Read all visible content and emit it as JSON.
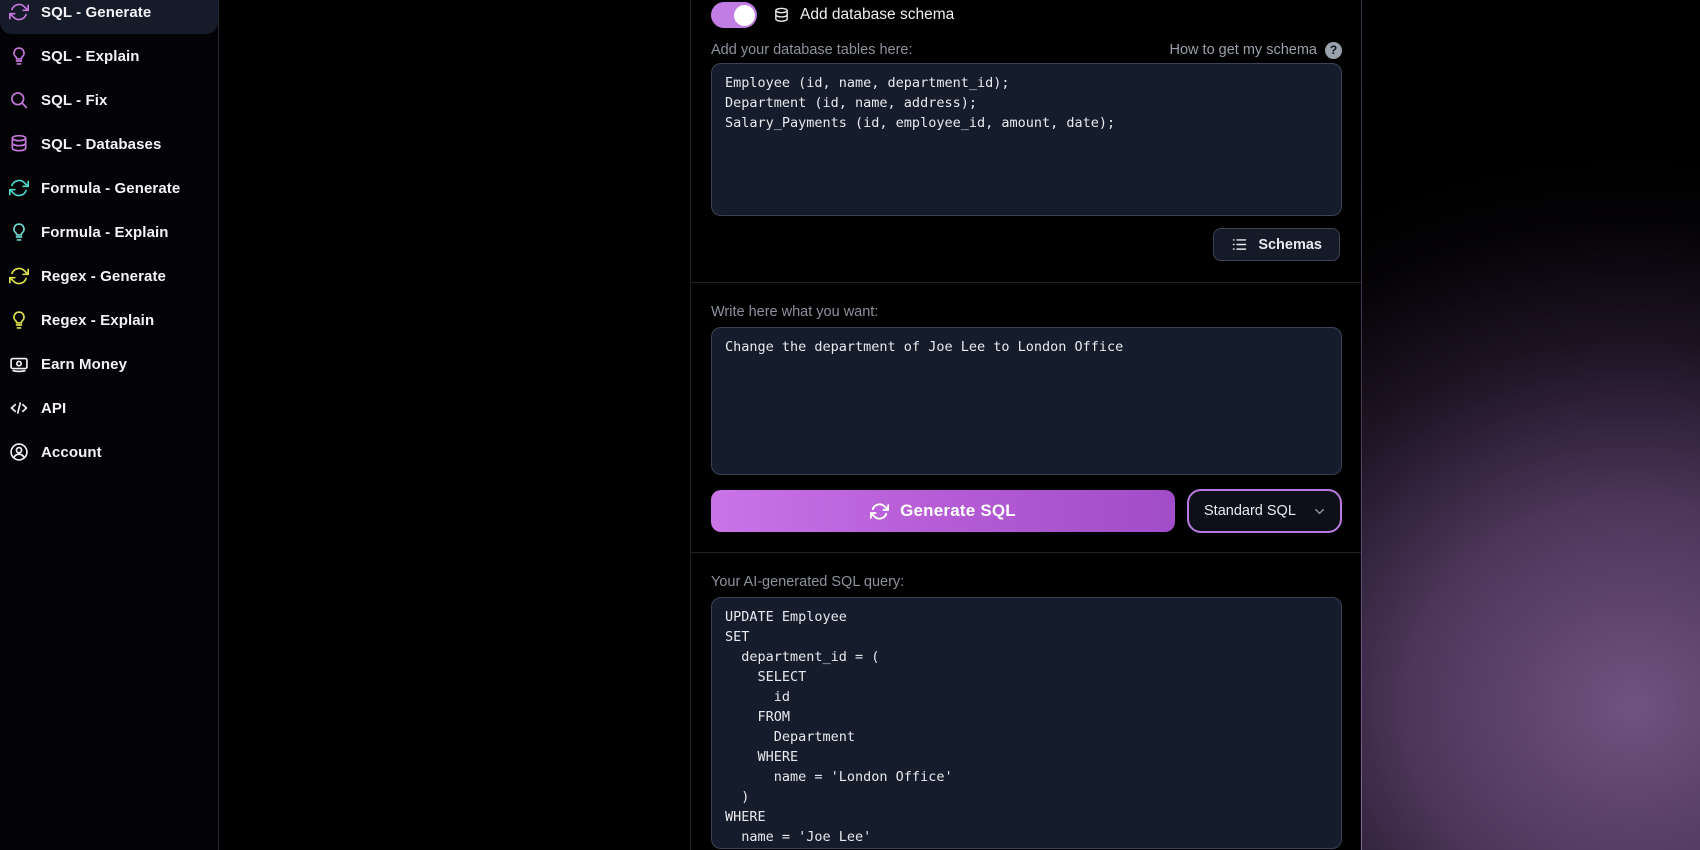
{
  "sidebar": {
    "items": [
      {
        "label": "SQL - Generate",
        "icon": "refresh-icon",
        "color": "#c678dd",
        "active": true
      },
      {
        "label": "SQL - Explain",
        "icon": "lightbulb-icon",
        "color": "#c678dd",
        "active": false
      },
      {
        "label": "SQL - Fix",
        "icon": "search-icon",
        "color": "#c678dd",
        "active": false
      },
      {
        "label": "SQL - Databases",
        "icon": "database-icon",
        "color": "#c678dd",
        "active": false
      },
      {
        "label": "Formula - Generate",
        "icon": "refresh-icon",
        "color": "#4ed6ca",
        "active": false
      },
      {
        "label": "Formula - Explain",
        "icon": "lightbulb-icon",
        "color": "#6fd9d1",
        "active": false
      },
      {
        "label": "Regex - Generate",
        "icon": "refresh-icon",
        "color": "#e0e14f",
        "active": false
      },
      {
        "label": "Regex - Explain",
        "icon": "lightbulb-icon",
        "color": "#e0e14f",
        "active": false
      },
      {
        "label": "Earn Money",
        "icon": "banknote-icon",
        "color": "#f2f2f4",
        "active": false
      },
      {
        "label": "API",
        "icon": "code-icon",
        "color": "#f2f2f4",
        "active": false
      },
      {
        "label": "Account",
        "icon": "user-icon",
        "color": "#f2f2f4",
        "active": false
      }
    ]
  },
  "schema_section": {
    "toggle_on": true,
    "toggle_label": "Add database schema",
    "field_label": "Add your database tables here:",
    "help_label": "How to get my schema",
    "help_glyph": "?",
    "textarea_value": "Employee (id, name, department_id);\nDepartment (id, name, address);\nSalary_Payments (id, employee_id, amount, date);",
    "schemas_button_label": "Schemas"
  },
  "prompt_section": {
    "label": "Write here what you want:",
    "textarea_value": "Change the department of Joe Lee to London Office",
    "generate_button_label": "Generate SQL",
    "dialect_selected": "Standard SQL"
  },
  "output_section": {
    "label": "Your AI-generated SQL query:",
    "sql": "UPDATE Employee\nSET\n  department_id = (\n    SELECT\n      id\n    FROM\n      Department\n    WHERE\n      name = 'London Office'\n  )\nWHERE\n  name = 'Joe Lee'"
  },
  "colors": {
    "toggle_track": "#c27de5",
    "sidebar_purple": "#c678dd",
    "sidebar_teal": "#4ed6ca",
    "sidebar_yellow": "#e0e14f",
    "panel_bg": "#151c2b",
    "panel_border": "#3a4257",
    "generate_gradient_from": "#ca74e8",
    "generate_gradient_to": "#a14cc9",
    "dropdown_border": "#b87ae0",
    "active_item_bg": "#161b29",
    "glow_purple": "#6f4f80"
  }
}
